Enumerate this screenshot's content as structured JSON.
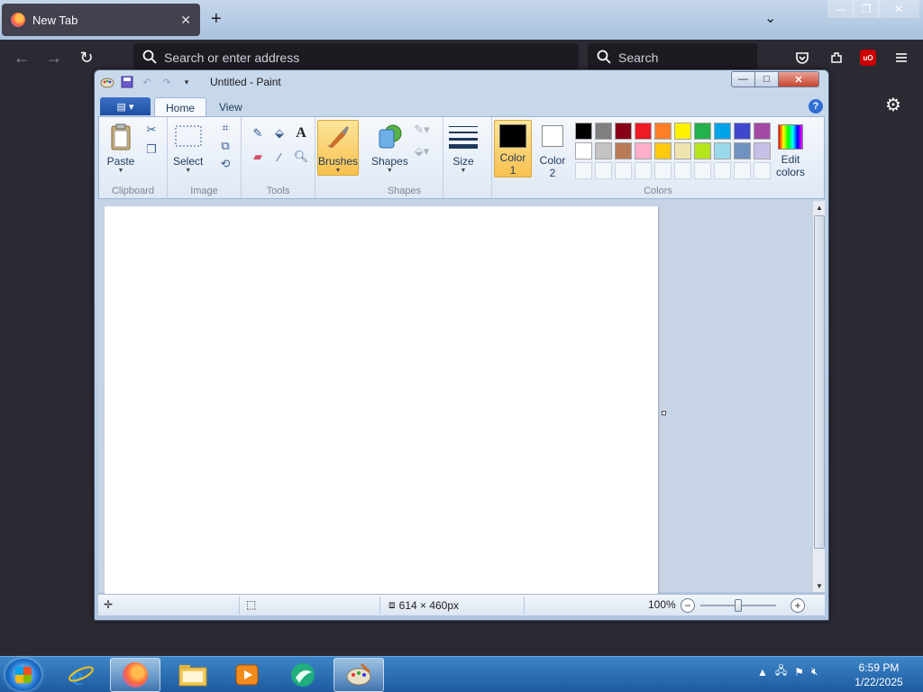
{
  "firefox": {
    "tab_title": "New Tab",
    "tab_close": "✕",
    "new_tab": "+",
    "list_all_tabs": "⌄",
    "url_placeholder": "Search or enter address",
    "search_placeholder": "Search",
    "ublock_label": "uO"
  },
  "paint": {
    "title": "Untitled - Paint",
    "tabs": [
      "Home",
      "View"
    ],
    "groups": {
      "clipboard": "Clipboard",
      "image": "Image",
      "tools": "Tools",
      "shapes": "Shapes",
      "colors": "Colors"
    },
    "buttons": {
      "paste": "Paste",
      "select": "Select",
      "brushes": "Brushes",
      "shapes": "Shapes",
      "size": "Size",
      "color1_line1": "Color",
      "color1_line2": "1",
      "color2_line1": "Color",
      "color2_line2": "2",
      "edit_colors_line1": "Edit",
      "edit_colors_line2": "colors"
    },
    "color1": "#000000",
    "color2": "#ffffff",
    "palette_row1": [
      "#000000",
      "#7f7f7f",
      "#880015",
      "#ed1c24",
      "#ff7f27",
      "#fff200",
      "#22b14c",
      "#00a2e8",
      "#3f48cc",
      "#a349a4"
    ],
    "palette_row2": [
      "#ffffff",
      "#c3c3c3",
      "#b97a57",
      "#ffaec9",
      "#ffc90e",
      "#efe4b0",
      "#b5e61d",
      "#99d9ea",
      "#7092be",
      "#c8bfe7"
    ],
    "status": {
      "image_size": "614 × 460px",
      "zoom": "100%"
    }
  },
  "taskbar": {
    "time": "6:59 PM",
    "date": "1/22/2025"
  }
}
